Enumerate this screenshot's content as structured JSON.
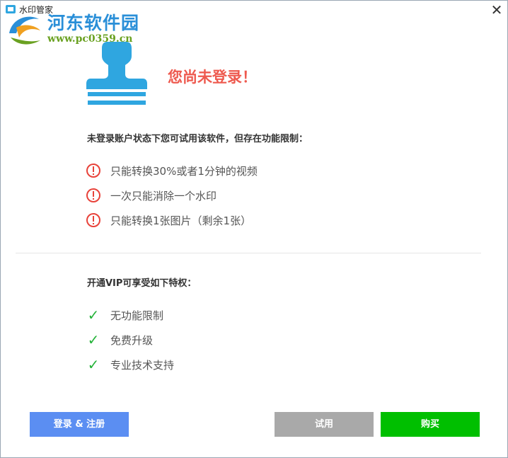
{
  "window": {
    "title": "水印管家",
    "close_glyph": "✕"
  },
  "watermark": {
    "site_name": "河东软件园",
    "url": "www.pc0359.cn"
  },
  "headline": "您尚未登录！",
  "intro": "未登录账户状态下您可试用该软件，但存在功能限制：",
  "limits": [
    {
      "icon": "warning-circle-icon",
      "text": "只能转换30%或者1分钟的视频"
    },
    {
      "icon": "warning-circle-icon",
      "text": "一次只能消除一个水印"
    },
    {
      "icon": "warning-circle-icon",
      "text": "只能转换1张图片（剩余1张）"
    }
  ],
  "vip": {
    "title": "开通VIP可享受如下特权：",
    "benefits": [
      {
        "icon": "checkmark-icon",
        "glyph": "✓",
        "text": "无功能限制"
      },
      {
        "icon": "checkmark-icon",
        "glyph": "✓",
        "text": "免费升级"
      },
      {
        "icon": "checkmark-icon",
        "glyph": "✓",
        "text": "专业技术支持"
      }
    ]
  },
  "buttons": {
    "login": "登录 & 注册",
    "trial": "试用",
    "buy": "购买"
  },
  "colors": {
    "stamp": "#2fa6e0",
    "headline": "#ee5a4f",
    "warning": "#e8423a",
    "check": "#25b33a",
    "login_btn": "#5b8ef2",
    "trial_btn": "#a9a9a9",
    "buy_btn": "#00bf00"
  }
}
